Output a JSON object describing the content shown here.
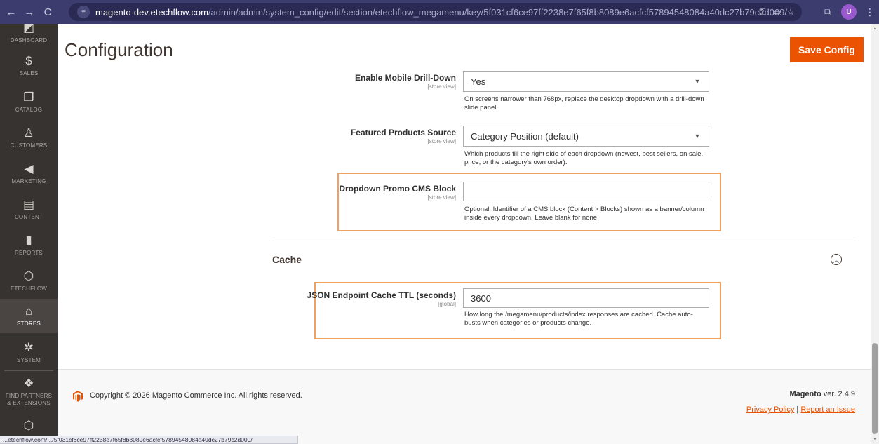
{
  "browser": {
    "url_host": "magento-dev.etechflow.com",
    "url_path": "/admin/admin/system_config/edit/section/etechflow_megamenu/key/5f031cf6ce97ff2238e7f65f8b8089e6acfcf57894548084a40dc27b79c2d009/",
    "profile_initial": "U",
    "status_url": "...etechflow.com/.../5f031cf6ce97ff2238e7f65f8b8089e6acfcf57894548084a40dc27b79c2d009/"
  },
  "sidebar": {
    "items": [
      {
        "label": "DASHBOARD",
        "icon": "dashboard-icon"
      },
      {
        "label": "SALES",
        "icon": "dollar-icon"
      },
      {
        "label": "CATALOG",
        "icon": "box-icon"
      },
      {
        "label": "CUSTOMERS",
        "icon": "person-icon"
      },
      {
        "label": "MARKETING",
        "icon": "megaphone-icon"
      },
      {
        "label": "CONTENT",
        "icon": "layout-icon"
      },
      {
        "label": "REPORTS",
        "icon": "bar-chart-icon"
      },
      {
        "label": "ETECHFLOW",
        "icon": "hexagon-icon"
      },
      {
        "label": "STORES",
        "icon": "store-icon"
      },
      {
        "label": "SYSTEM",
        "icon": "gear-icon"
      },
      {
        "label": "FIND PARTNERS & EXTENSIONS",
        "icon": "cube-icon"
      }
    ]
  },
  "header": {
    "title": "Configuration",
    "save_label": "Save Config"
  },
  "fields": {
    "mobile_drilldown": {
      "label": "Enable Mobile Drill-Down",
      "scope": "[store view]",
      "value": "Yes",
      "note": "On screens narrower than 768px, replace the desktop dropdown with a drill-down slide panel."
    },
    "featured_source": {
      "label": "Featured Products Source",
      "scope": "[store view]",
      "value": "Category Position (default)",
      "note": "Which products fill the right side of each dropdown (newest, best sellers, on sale, price, or the category's own order)."
    },
    "promo_block": {
      "label": "Dropdown Promo CMS Block",
      "scope": "[store view]",
      "value": "",
      "note": "Optional. Identifier of a CMS block (Content > Blocks) shown as a banner/column inside every dropdown. Leave blank for none."
    },
    "cache_ttl": {
      "label": "JSON Endpoint Cache TTL (seconds)",
      "scope": "[global]",
      "value": "3600",
      "note": "How long the /megamenu/products/index responses are cached. Cache auto-busts when categories or products change."
    }
  },
  "sections": {
    "cache_title": "Cache"
  },
  "footer": {
    "copyright": "Copyright © 2026 Magento Commerce Inc. All rights reserved.",
    "brand": "Magento",
    "version": "ver. 2.4.9",
    "privacy": "Privacy Policy",
    "separator": "|",
    "report": "Report an Issue"
  },
  "colors": {
    "accent": "#eb5202",
    "sidebar_bg": "#373330",
    "highlight_border": "#f0a15d"
  }
}
